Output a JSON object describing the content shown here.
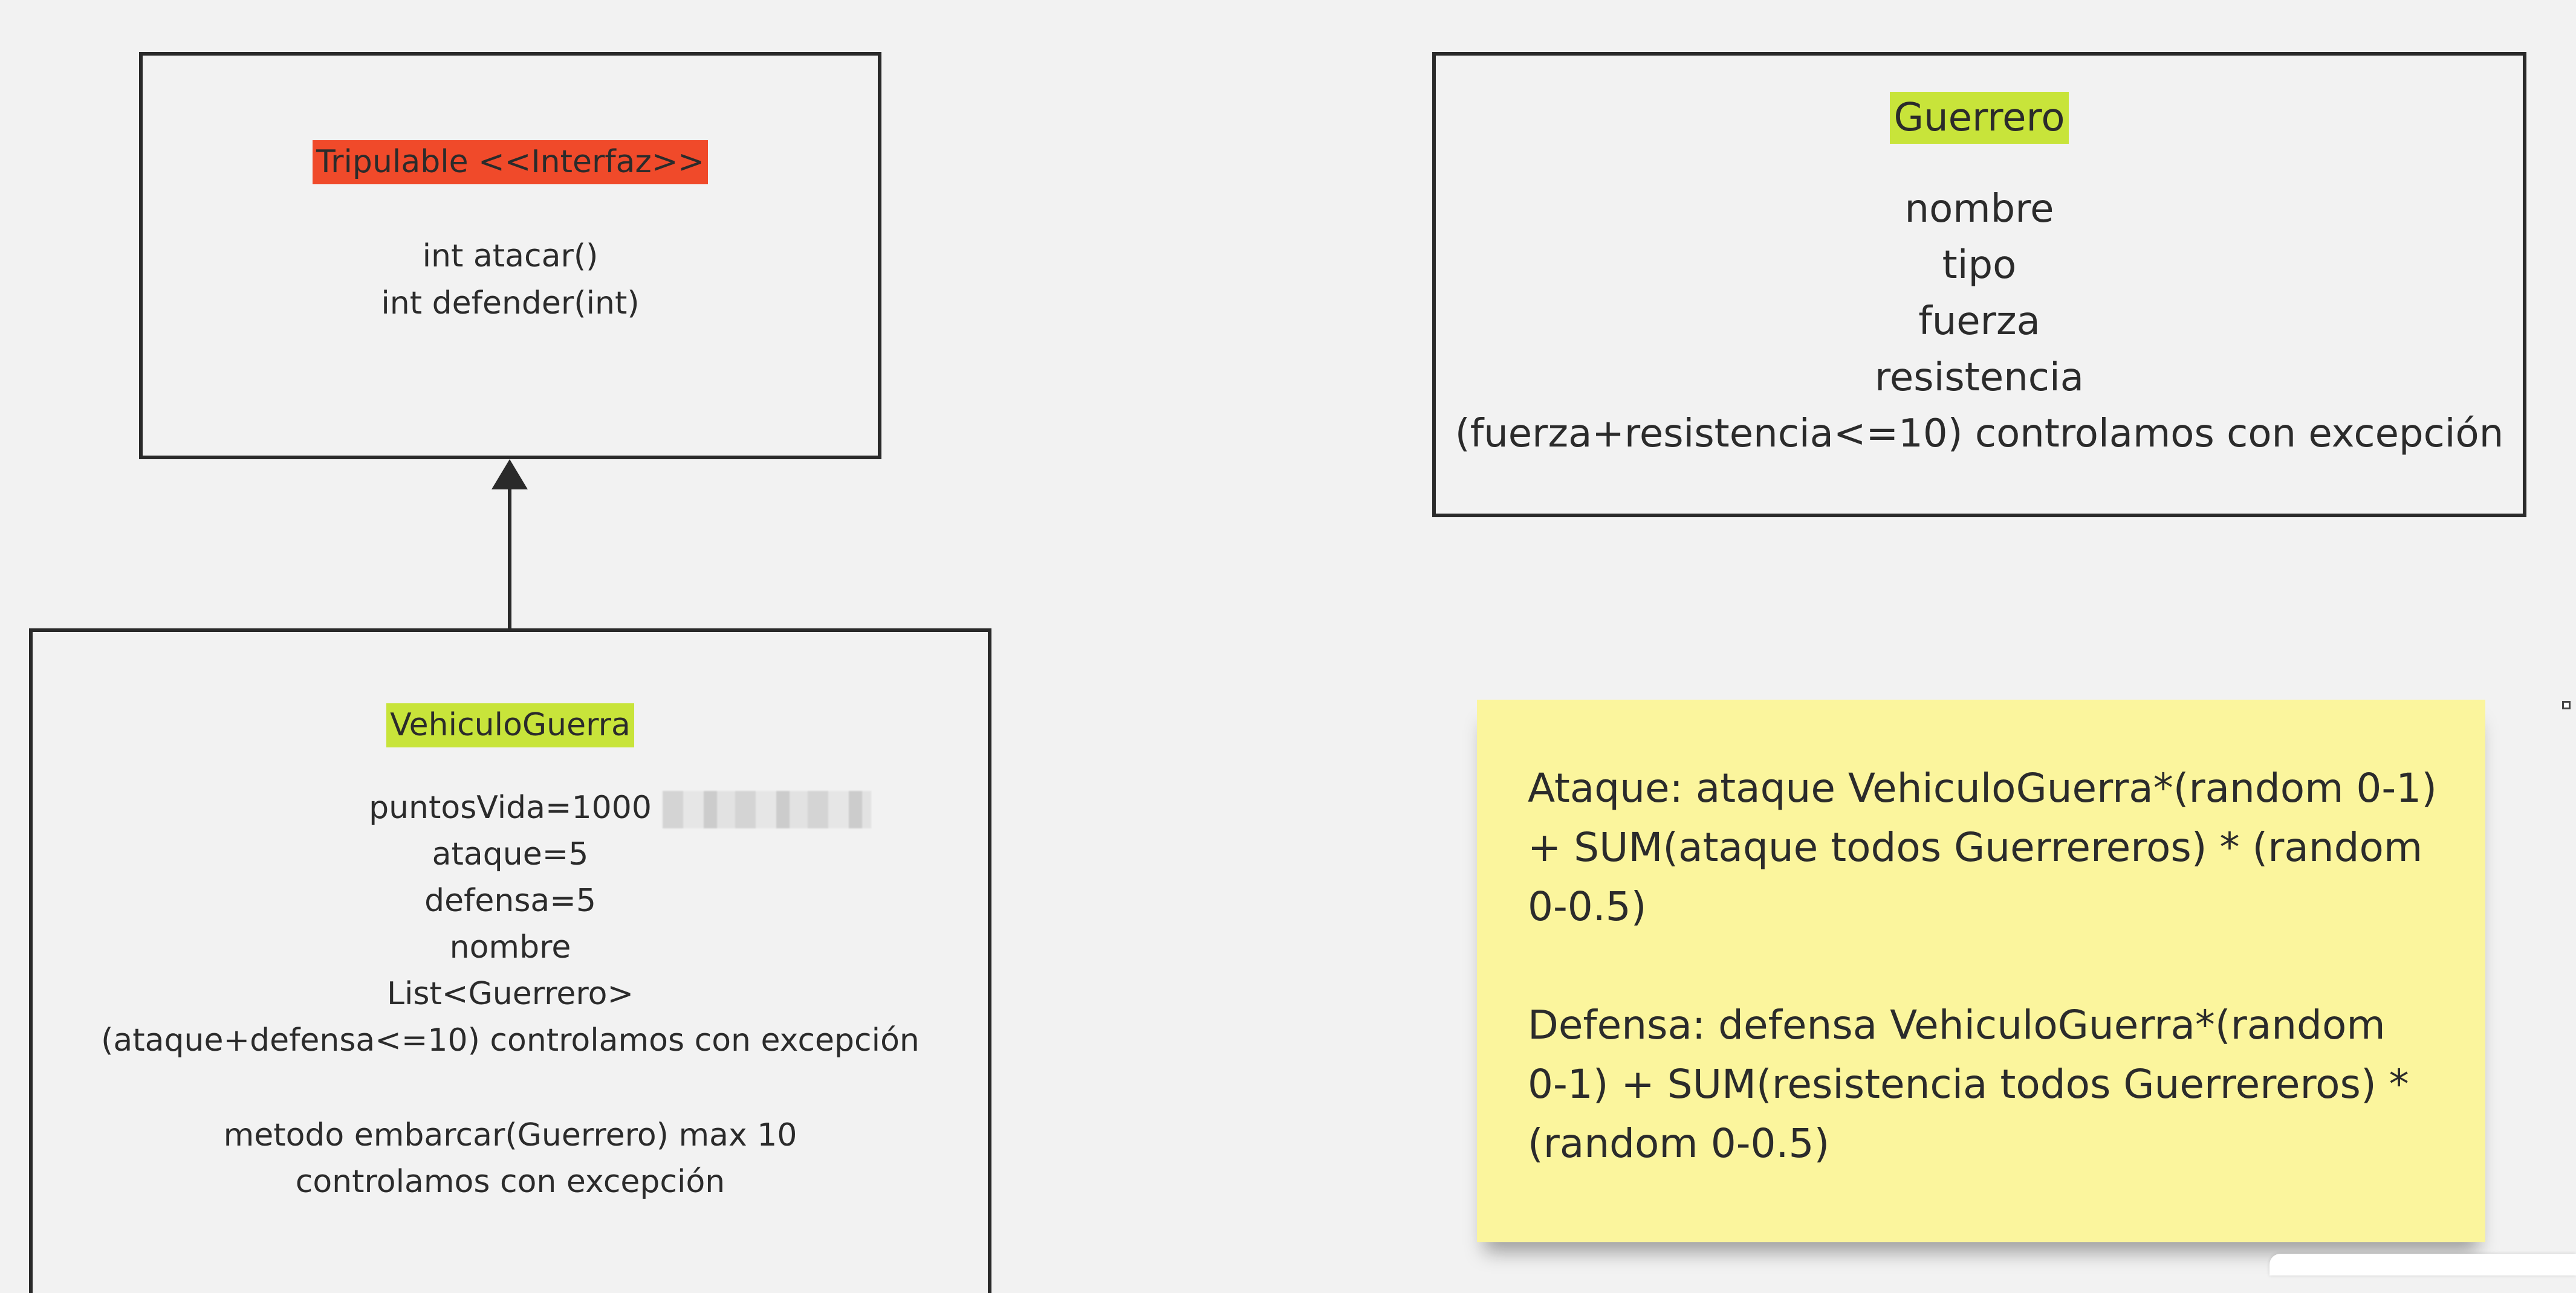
{
  "diagram": {
    "tripulable": {
      "title": "Tripulable <<Interfaz>>",
      "methods": [
        "int atacar()",
        "int defender(int)"
      ]
    },
    "vehiculo_guerra": {
      "title": "VehiculoGuerra",
      "attributes": [
        "puntosVida=1000",
        "ataque=5",
        "defensa=5",
        "nombre",
        "List<Guerrero>",
        "(ataque+defensa<=10) controlamos con excepción"
      ],
      "methods": [
        "metodo embarcar(Guerrero) max 10",
        "controlamos con excepción"
      ]
    },
    "guerrero": {
      "title": "Guerrero",
      "attributes": [
        "nombre",
        "tipo",
        "fuerza",
        "resistencia",
        "(fuerza+resistencia<=10) controlamos con excepción"
      ]
    },
    "note": {
      "paragraphs": [
        "Ataque: ataque VehiculoGuerra*(random 0-1)\n+ SUM(ataque todos Guerrereros) * (random\n0-0.5)",
        "Defensa:  defensa VehiculoGuerra*(random\n0-1) + SUM(resistencia todos Guerrereros) *\n(random 0-0.5)"
      ]
    }
  },
  "colors": {
    "interface_highlight": "#f04a2a",
    "class_highlight": "#c8e43a",
    "sticky_note": "#fbf59d",
    "canvas": "#f2f2f2",
    "stroke": "#2a2a2a"
  },
  "icons": {
    "connector_head": "arrow-up-icon"
  }
}
